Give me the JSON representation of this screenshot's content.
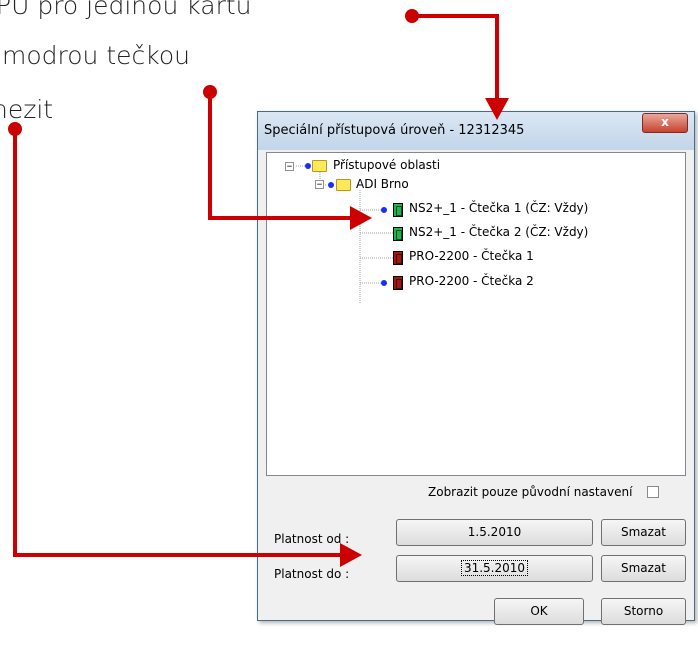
{
  "annotations": {
    "line1": "PU pro jedinou kartu",
    "line2": "modrou tečkou",
    "line3": "nezit"
  },
  "dialog": {
    "title": "Speciální přístupová úroveň - 12312345",
    "close_glyph": "x"
  },
  "tree": {
    "root": {
      "label": "Přístupové oblasti",
      "expander": "−"
    },
    "site": {
      "label": "ADI Brno",
      "expander": "−"
    },
    "readers": [
      {
        "label": "NS2+_1 - Čtečka 1 (ČZ: Vždy)",
        "status": "green",
        "dot": true
      },
      {
        "label": "NS2+_1 - Čtečka 2 (ČZ: Vždy)",
        "status": "green",
        "dot": false
      },
      {
        "label": "PRO-2200 - Čtečka 1",
        "status": "red",
        "dot": false
      },
      {
        "label": "PRO-2200 - Čtečka 2",
        "status": "red",
        "dot": true
      }
    ]
  },
  "show_original_label": "Zobrazit pouze původní nastavení",
  "show_original_checked": false,
  "valid_from": {
    "label": "Platnost od :",
    "value": "1.5.2010",
    "clear_label": "Smazat"
  },
  "valid_to": {
    "label": "Platnost do :",
    "value": "31.5.2010",
    "clear_label": "Smazat"
  },
  "ok_label": "OK",
  "cancel_label": "Storno",
  "colors": {
    "annotation_red": "#cc0000",
    "dot_blue": "#1a2cff",
    "reader_green": "#22b14c",
    "reader_red": "#a11a12"
  }
}
